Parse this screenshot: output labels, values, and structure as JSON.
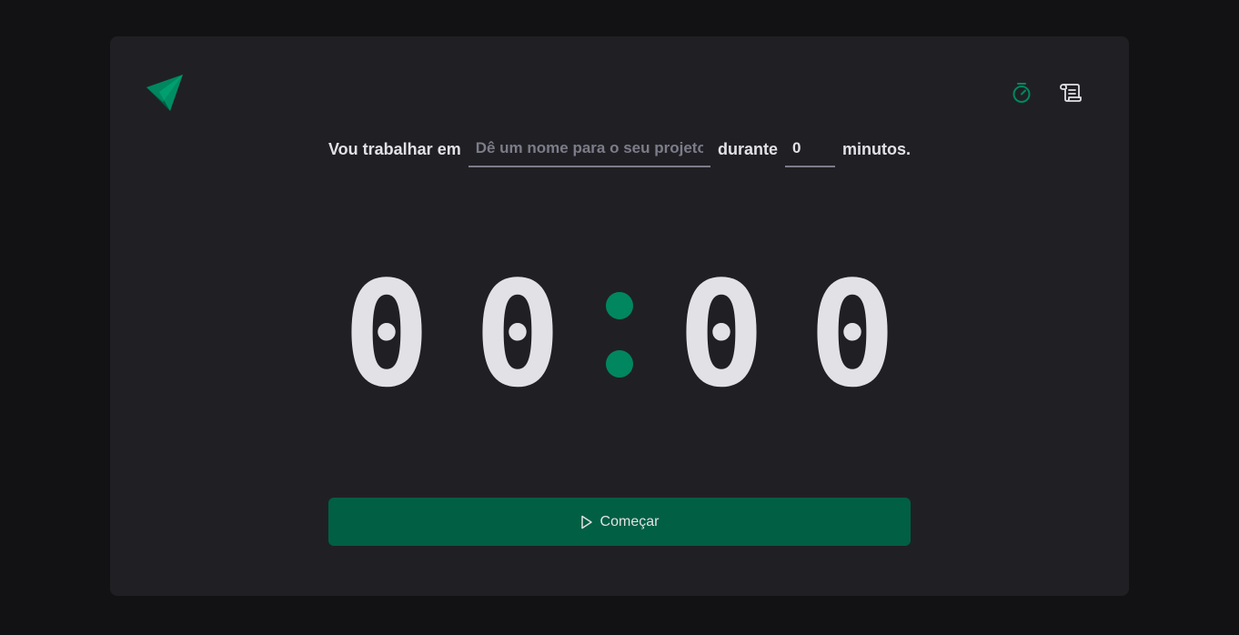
{
  "nav": {
    "timer_icon": "timer-icon",
    "history_icon": "scroll-icon",
    "active_color": "#00875f"
  },
  "form": {
    "prefix_label": "Vou trabalhar em",
    "project_placeholder": "Dê um nome para o seu projeto",
    "project_value": "",
    "middle_label": "durante",
    "minutes_value": "0",
    "suffix_label": "minutos."
  },
  "countdown": {
    "minutes_tens": "0",
    "minutes_units": "0",
    "seconds_tens": "0",
    "seconds_units": "0"
  },
  "start_button": {
    "label": "Começar",
    "icon": "play-icon",
    "color": "#015f43"
  },
  "colors": {
    "brand": "#00875f",
    "background": "#121214",
    "panel": "#202024"
  }
}
